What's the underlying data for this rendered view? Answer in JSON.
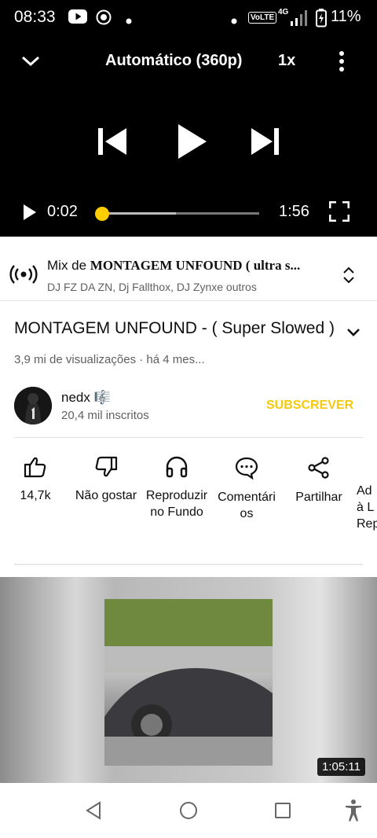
{
  "status_bar": {
    "time": "08:33",
    "battery": "11%",
    "network": "4G",
    "volte": "VoLTE",
    "icons": [
      "youtube-icon",
      "record-icon",
      "dot-icon",
      "dot-icon",
      "signal-icon",
      "battery-icon"
    ]
  },
  "player": {
    "quality": "Automático (360p)",
    "speed": "1x",
    "current_time": "0:02",
    "duration": "1:56",
    "progress_fraction": 0.017,
    "buffered_fraction": 0.47,
    "accent_color": "#ffcc00"
  },
  "mix": {
    "prefix": "Mix de ",
    "song": "MONTAGEM UNFOUND ( ultra s...",
    "artists": "DJ FZ DA ZN, Dj Fallthox, DJ Zynxe outros"
  },
  "video": {
    "title": "MONTAGEM UNFOUND - ( Super Slowed )",
    "meta": "3,9 mi de visualizações · há 4 mes..."
  },
  "channel": {
    "name": "nedx 🎼",
    "subscribers": "20,4 mil inscritos",
    "subscribe_label": "SUBSCREVER",
    "subscribe_color": "#f6c90e"
  },
  "actions": [
    {
      "label": "14,7k",
      "icon": "thumbs-up-icon"
    },
    {
      "label": "Não gostar",
      "icon": "thumbs-down-icon"
    },
    {
      "label_line1": "Reproduzir",
      "label_line2": "no Fundo",
      "icon": "headphones-icon"
    },
    {
      "label_line1": "Comentári",
      "label_line2": "os",
      "icon": "comment-icon"
    },
    {
      "label": "Partilhar",
      "icon": "share-icon"
    },
    {
      "label_line1": "Ad",
      "label_line2": "à L",
      "label_line3": "Rep",
      "icon": "add-to-list-icon"
    }
  ],
  "next_video": {
    "duration": "1:05:11"
  },
  "nav": {
    "icons": [
      "back-icon",
      "home-icon",
      "recents-icon",
      "accessibility-icon"
    ]
  }
}
